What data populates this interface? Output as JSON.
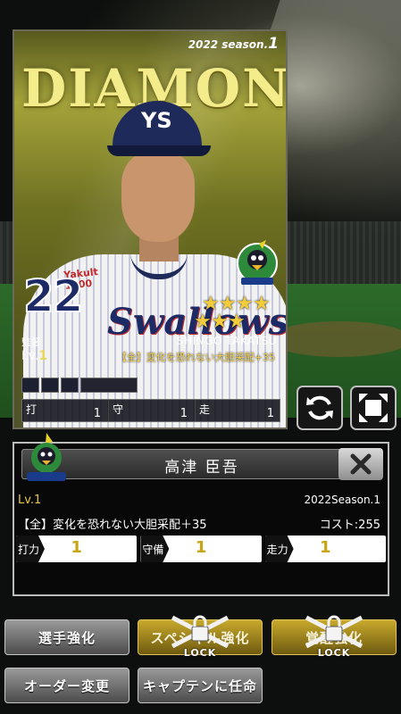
{
  "card": {
    "rarity": "DIAMOND",
    "season_prefix": "2022 season.",
    "season_num": "1",
    "sponsor_line1": "Yakult",
    "sponsor_line2": "1000",
    "jersey_script": "Swallows",
    "cap_logo": "YS",
    "number": "22",
    "stars": [
      "★",
      "★",
      "★",
      "★",
      "★",
      "★",
      "★"
    ],
    "position": "監督",
    "level_prefix": "Lv.",
    "level_value": "1",
    "name_en": "SHINGO TAKATSU",
    "skill": "【全】変化を恐れない大胆采配+35",
    "stat_bar": [
      {
        "label": "打",
        "value": "1"
      },
      {
        "label": "守",
        "value": "1"
      },
      {
        "label": "走",
        "value": "1"
      }
    ]
  },
  "buttons_icons": {
    "refresh": "refresh-icon",
    "expand": "expand-icon"
  },
  "panel": {
    "name": "高津 臣吾",
    "level": "Lv.1",
    "season": "2022Season.1",
    "skill": "【全】変化を恐れない大胆采配＋35",
    "cost": "コスト:255",
    "stats": [
      {
        "label": "打力",
        "value": "1"
      },
      {
        "label": "守備",
        "value": "1"
      },
      {
        "label": "走力",
        "value": "1"
      }
    ]
  },
  "actions": {
    "enhance": "選手強化",
    "special": "スペシャル強化",
    "awaken": "覚醒強化",
    "order": "オーダー変更",
    "captain": "キャプテンに任命",
    "lock_text": "LOCK"
  },
  "colors": {
    "gold": "#c8a92c",
    "star": "#f2cc3a",
    "stat_value": "#c7a516",
    "team_navy": "#1c2b66"
  }
}
